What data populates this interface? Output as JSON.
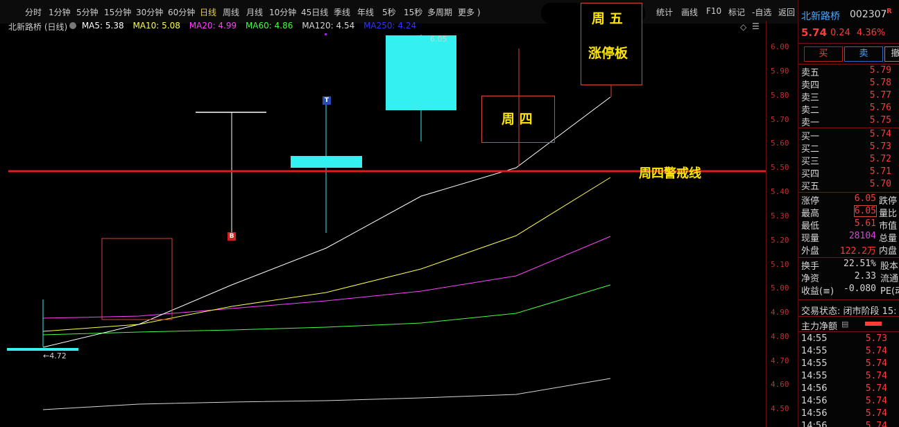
{
  "toolbar": {
    "periods": [
      "分时",
      "1分钟",
      "5分钟",
      "15分钟",
      "30分钟",
      "60分钟",
      "日线",
      "周线",
      "月线",
      "10分钟",
      "45日线",
      "季线",
      "年线",
      "5秒",
      "15秒",
      "多周期",
      "更多 )"
    ],
    "active_period": "日线",
    "right_tools": [
      "统计",
      "画线",
      "F10",
      "标记",
      "-自选",
      "返回"
    ]
  },
  "chart": {
    "title": "北新路桥 (日线)",
    "ma": [
      {
        "label": "MA5: 5.38",
        "color": "#ffffff"
      },
      {
        "label": "MA10: 5.08",
        "color": "#ffff44"
      },
      {
        "label": "MA20: 4.99",
        "color": "#ff44ff"
      },
      {
        "label": "MA60: 4.86",
        "color": "#44ff44"
      },
      {
        "label": "MA120: 4.54",
        "color": "#d8d8d8"
      },
      {
        "label": "MA250: 4.24",
        "color": "#3333ff"
      }
    ],
    "high_label": "6.05",
    "low_label": "←4.72",
    "marker_b": "B",
    "marker_t": "T",
    "price_ticks": [
      "6.00",
      "5.90",
      "5.80",
      "5.70",
      "5.60",
      "5.50",
      "5.40",
      "5.30",
      "5.20",
      "5.10",
      "5.00",
      "4.90",
      "4.80",
      "4.70",
      "4.60",
      "4.50"
    ]
  },
  "annotations": {
    "thu_box": "周 四",
    "fri_box_line1": "周 五",
    "fri_box_line2": "涨停板",
    "warning_line": "周四警戒线"
  },
  "quote": {
    "name": "北新路桥",
    "code": "002307",
    "code_badge": "R",
    "price": "5.74",
    "change": "0.24",
    "change_pct": "4.36%",
    "buy_label": "买",
    "sell_label": "卖",
    "other_label": "撤",
    "asks": [
      {
        "label": "卖五",
        "price": "5.79"
      },
      {
        "label": "卖四",
        "price": "5.78"
      },
      {
        "label": "卖三",
        "price": "5.77"
      },
      {
        "label": "卖二",
        "price": "5.76"
      },
      {
        "label": "卖一",
        "price": "5.75"
      }
    ],
    "bids": [
      {
        "label": "买一",
        "price": "5.74"
      },
      {
        "label": "买二",
        "price": "5.73"
      },
      {
        "label": "买三",
        "price": "5.72"
      },
      {
        "label": "买四",
        "price": "5.71"
      },
      {
        "label": "买五",
        "price": "5.70"
      }
    ],
    "stats": [
      {
        "label": "涨停",
        "value": "6.05",
        "color": "#ff3b3b",
        "extra": "跌停"
      },
      {
        "label": "最高",
        "value": "6.05",
        "color": "#ff3b3b",
        "extra": "量比",
        "boxed": true
      },
      {
        "label": "最低",
        "value": "5.61",
        "color": "#ff3b3b",
        "extra": "市值"
      },
      {
        "label": "现量",
        "value": "28104",
        "color": "#e040e0",
        "extra": "总量"
      },
      {
        "label": "外盘",
        "value": "122.2万",
        "color": "#ff3b3b",
        "extra": "内盘"
      }
    ],
    "stats2": [
      {
        "label": "换手",
        "value": "22.51%",
        "extra": "股本"
      },
      {
        "label": "净资",
        "value": "2.33",
        "extra": "流通"
      },
      {
        "label": "收益(≡)",
        "value": "-0.080",
        "extra": "PE(动"
      }
    ],
    "status": "交易状态: 闭市阶段 15:",
    "main_flow_label": "主力净额",
    "ticks": [
      {
        "time": "14:55",
        "price": "5.73"
      },
      {
        "time": "14:55",
        "price": "5.74"
      },
      {
        "time": "14:55",
        "price": "5.74"
      },
      {
        "time": "14:55",
        "price": "5.74"
      },
      {
        "time": "14:56",
        "price": "5.74"
      },
      {
        "time": "14:56",
        "price": "5.74"
      },
      {
        "time": "14:56",
        "price": "5.74"
      },
      {
        "time": "14:56",
        "price": "5.74"
      }
    ]
  }
}
